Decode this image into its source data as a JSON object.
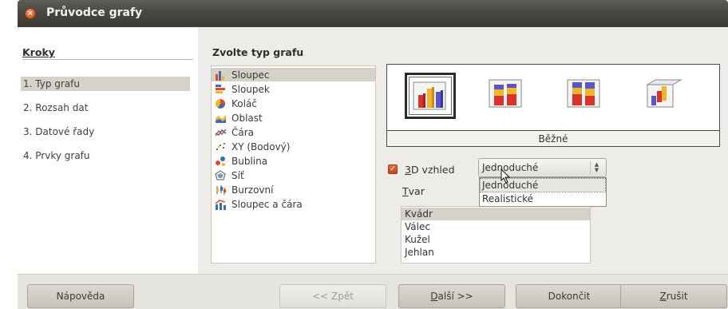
{
  "window": {
    "title": "Průvodce grafy"
  },
  "steps": {
    "title": "Kroky",
    "items": [
      {
        "label": "1. Typ grafu",
        "selected": true
      },
      {
        "label": "2. Rozsah dat",
        "selected": false
      },
      {
        "label": "3. Datové řady",
        "selected": false
      },
      {
        "label": "4. Prvky grafu",
        "selected": false
      }
    ]
  },
  "chart_types": {
    "title": "Zvolte typ grafu",
    "items": [
      {
        "label": "Sloupec",
        "icon": "column-chart-icon",
        "selected": true
      },
      {
        "label": "Sloupek",
        "icon": "bar-chart-icon"
      },
      {
        "label": "Koláč",
        "icon": "pie-chart-icon"
      },
      {
        "label": "Oblast",
        "icon": "area-chart-icon"
      },
      {
        "label": "Čára",
        "icon": "line-chart-icon"
      },
      {
        "label": "XY (Bodový)",
        "icon": "scatter-chart-icon"
      },
      {
        "label": "Bublina",
        "icon": "bubble-chart-icon"
      },
      {
        "label": "Síť",
        "icon": "net-chart-icon"
      },
      {
        "label": "Burzovní",
        "icon": "stock-chart-icon"
      },
      {
        "label": "Sloupec a čára",
        "icon": "column-line-chart-icon"
      }
    ]
  },
  "variants": {
    "caption": "Běžné",
    "items": [
      "normal-3d-column-icon",
      "stacked-3d-column-icon",
      "percent-stacked-3d-column-icon",
      "deep-3d-column-icon"
    ],
    "selected_index": 0
  },
  "options": {
    "look_3d_checked": true,
    "look_3d_label_underlined": "3",
    "look_3d_label_rest": "D vzhled",
    "look_value": "Jednoduché",
    "look_options": [
      "Jednoduché",
      "Realistické"
    ],
    "shape_label_underlined": "T",
    "shape_label_rest": "var",
    "shapes": [
      "Kvádr",
      "Válec",
      "Kužel",
      "Jehlan"
    ],
    "shape_selected": "Kvádr"
  },
  "buttons": {
    "help": "Nápověda",
    "back": "<< Zpět",
    "next_underlined": "D",
    "next_rest": "alší >>",
    "finish": "Dokončit",
    "cancel_underlined": "Z",
    "cancel_rest": "rušit"
  },
  "colors": {
    "accent": "#e5642f",
    "selection": "#d6d2ca",
    "titlebar": "#45443f"
  }
}
